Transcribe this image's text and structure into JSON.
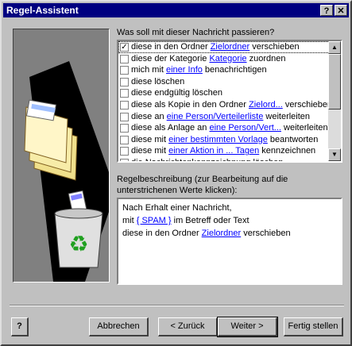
{
  "window": {
    "title": "Regel-Assistent",
    "help_btn": "?",
    "close_btn": "✕"
  },
  "question": "Was soll mit dieser Nachricht passieren?",
  "actions": [
    {
      "checked": true,
      "parts": [
        {
          "t": "diese in den Ordner "
        },
        {
          "t": "Zielordner",
          "link": true
        },
        {
          "t": " verschieben"
        }
      ]
    },
    {
      "checked": false,
      "parts": [
        {
          "t": "diese der Kategorie "
        },
        {
          "t": "Kategorie",
          "link": true
        },
        {
          "t": " zuordnen"
        }
      ]
    },
    {
      "checked": false,
      "parts": [
        {
          "t": "mich mit "
        },
        {
          "t": "einer Info",
          "link": true
        },
        {
          "t": " benachrichtigen"
        }
      ]
    },
    {
      "checked": false,
      "parts": [
        {
          "t": "diese löschen"
        }
      ]
    },
    {
      "checked": false,
      "parts": [
        {
          "t": "diese endgültig löschen"
        }
      ]
    },
    {
      "checked": false,
      "parts": [
        {
          "t": "diese als Kopie in den Ordner "
        },
        {
          "t": "Zielord...",
          "link": true
        },
        {
          "t": "  verschieben"
        }
      ]
    },
    {
      "checked": false,
      "parts": [
        {
          "t": "diese an "
        },
        {
          "t": "eine Person/Verteilerliste",
          "link": true
        },
        {
          "t": " weiterleiten"
        }
      ]
    },
    {
      "checked": false,
      "parts": [
        {
          "t": "diese als Anlage an "
        },
        {
          "t": "eine Person/Vert...",
          "link": true
        },
        {
          "t": "  weiterleiten"
        }
      ]
    },
    {
      "checked": false,
      "parts": [
        {
          "t": "diese mit "
        },
        {
          "t": "einer bestimmten Vorlage",
          "link": true
        },
        {
          "t": " beantworten"
        }
      ]
    },
    {
      "checked": false,
      "parts": [
        {
          "t": "diese mit "
        },
        {
          "t": "einer Aktion in ... Tagen",
          "link": true
        },
        {
          "t": " kennzeichnen"
        }
      ]
    },
    {
      "checked": false,
      "parts": [
        {
          "t": "die Nachrichtenkennzeichnung löschen"
        }
      ]
    }
  ],
  "desc_label_line1": "Regelbeschreibung (zur Bearbeitung auf die",
  "desc_label_line2": "unterstrichenen Werte klicken):",
  "description": {
    "line1": "Nach Erhalt einer Nachricht,",
    "line2_pre": "mit ",
    "line2_link": "{ SPAM }",
    "line2_post": " im Betreff oder Text",
    "line3_pre": "diese in den Ordner ",
    "line3_link": "Zielordner",
    "line3_post": " verschieben"
  },
  "buttons": {
    "help_icon": "?",
    "cancel": "Abbrechen",
    "back": "< Zurück",
    "next": "Weiter >",
    "finish": "Fertig stellen"
  }
}
